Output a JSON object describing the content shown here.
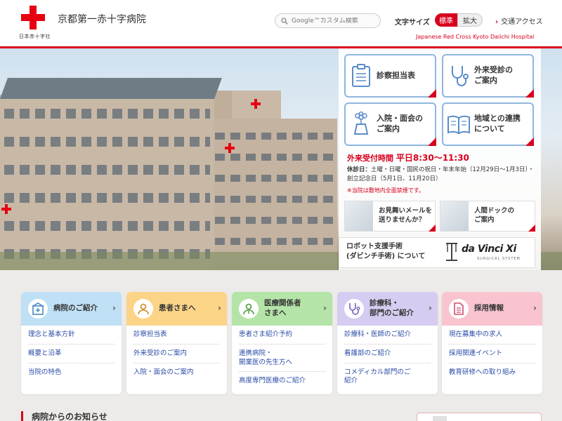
{
  "header": {
    "org_name": "日本赤十字社",
    "hospital_name": "京都第一赤十字病院",
    "search_placeholder": "Google™カスタム検索",
    "font_size_label": "文字サイズ",
    "font_size_standard": "標準",
    "font_size_large": "拡大",
    "access_link": "交通アクセス",
    "english_name": "Japanese Red Cross Kyoto Daiichi Hospital"
  },
  "quick_links": [
    {
      "label": "診察担当表",
      "icon": "clipboard-icon"
    },
    {
      "label": "外来受診の\nご案内",
      "icon": "stethoscope-icon"
    },
    {
      "label": "入院・面会の\nご案内",
      "icon": "flower-vase-icon"
    },
    {
      "label": "地域との連携\nについて",
      "icon": "book-icon"
    }
  ],
  "hours": {
    "label": "外来受付時間",
    "time": "平日8:30〜11:30",
    "closed_label": "休診日：",
    "closed_text": "土曜・日曜・国民の祝日・年末年始（12月29日〜1月3日）・創立記念日（5月1日、11月20日）",
    "note": "※当院は敷地内全面禁煙です。"
  },
  "banners": [
    {
      "label": "お見舞いメールを\n送りませんか？"
    },
    {
      "label": "人間ドックの\nご案内"
    }
  ],
  "robot_banner": {
    "label": "ロボット支援手術\n(ダビンチ手術) について",
    "logo_text": "da Vinci Xi",
    "logo_sub": "SURGICAL SYSTEM"
  },
  "cards": [
    {
      "title": "病院のご紹介",
      "icon": "hospital-icon",
      "color": "#bfe0f5",
      "items": [
        "理念と基本方針",
        "概要と沿革",
        "当院の特色"
      ]
    },
    {
      "title": "患者さまへ",
      "icon": "person-icon",
      "color": "#fcd488",
      "items": [
        "診察担当表",
        "外来受診のご案内",
        "入院・面会のご案内"
      ]
    },
    {
      "title": "医療関係者\nさまへ",
      "icon": "doctor-icon",
      "color": "#b5e4a8",
      "items": [
        "患者さま紹介予約",
        "連携病院・\n開業医の先生方へ",
        "高度専門医療のご紹介"
      ]
    },
    {
      "title": "診療科・\n部門のご紹介",
      "icon": "stethoscope-icon",
      "color": "#d6cbf0",
      "items": [
        "診療科・医師のご紹介",
        "看護部のご紹介",
        "コメディカル部門のご\n紹介"
      ]
    },
    {
      "title": "採用情報",
      "icon": "document-icon",
      "color": "#f9c4cf",
      "items": [
        "現在募集中の求人",
        "採用関連イベント",
        "教育研修への取り組み"
      ]
    }
  ],
  "news": {
    "title": "病院からのお知らせ"
  },
  "colors": {
    "brand_red": "#d8001c",
    "link_blue": "#2b4ba8",
    "quick_border": "#8fb7de"
  }
}
